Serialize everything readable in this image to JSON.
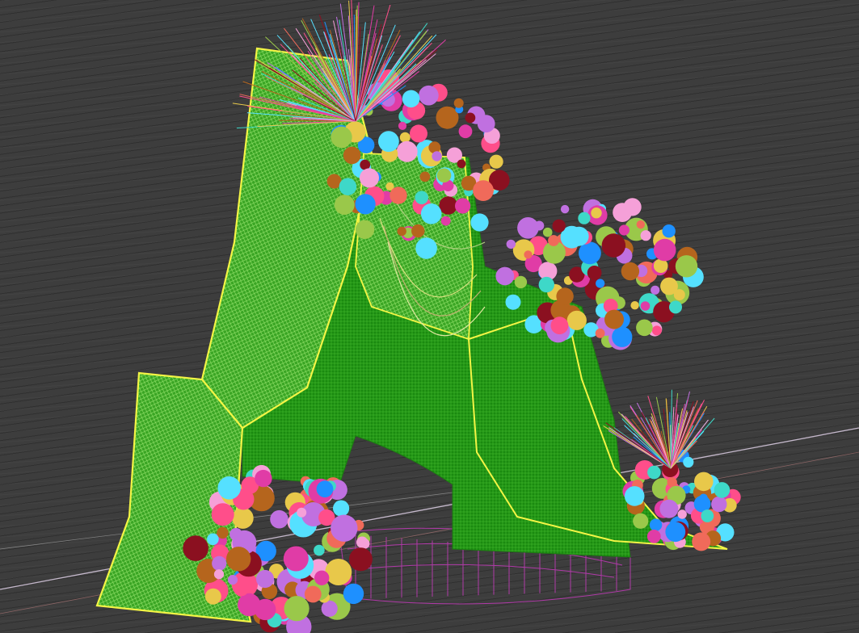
{
  "viewport": {
    "background_color": "#3d3d3d",
    "grid_line_color": "#2f2f2f"
  },
  "scene": {
    "wireframe_color": "#2e8b1a",
    "fabric_color": "#7bd14a",
    "selection_outline_color": "#f3f545",
    "stage_edge_color": "#b03aa8",
    "axis_line_color": "#e8d8f0",
    "flower_palette": [
      "#e03ca6",
      "#f06a5a",
      "#e8c84a",
      "#3ed8c8",
      "#1e90ff",
      "#8b1020",
      "#b5651d",
      "#f5a0d8",
      "#55e0ff",
      "#ff4e8a",
      "#c070e0",
      "#9ac84a"
    ]
  }
}
